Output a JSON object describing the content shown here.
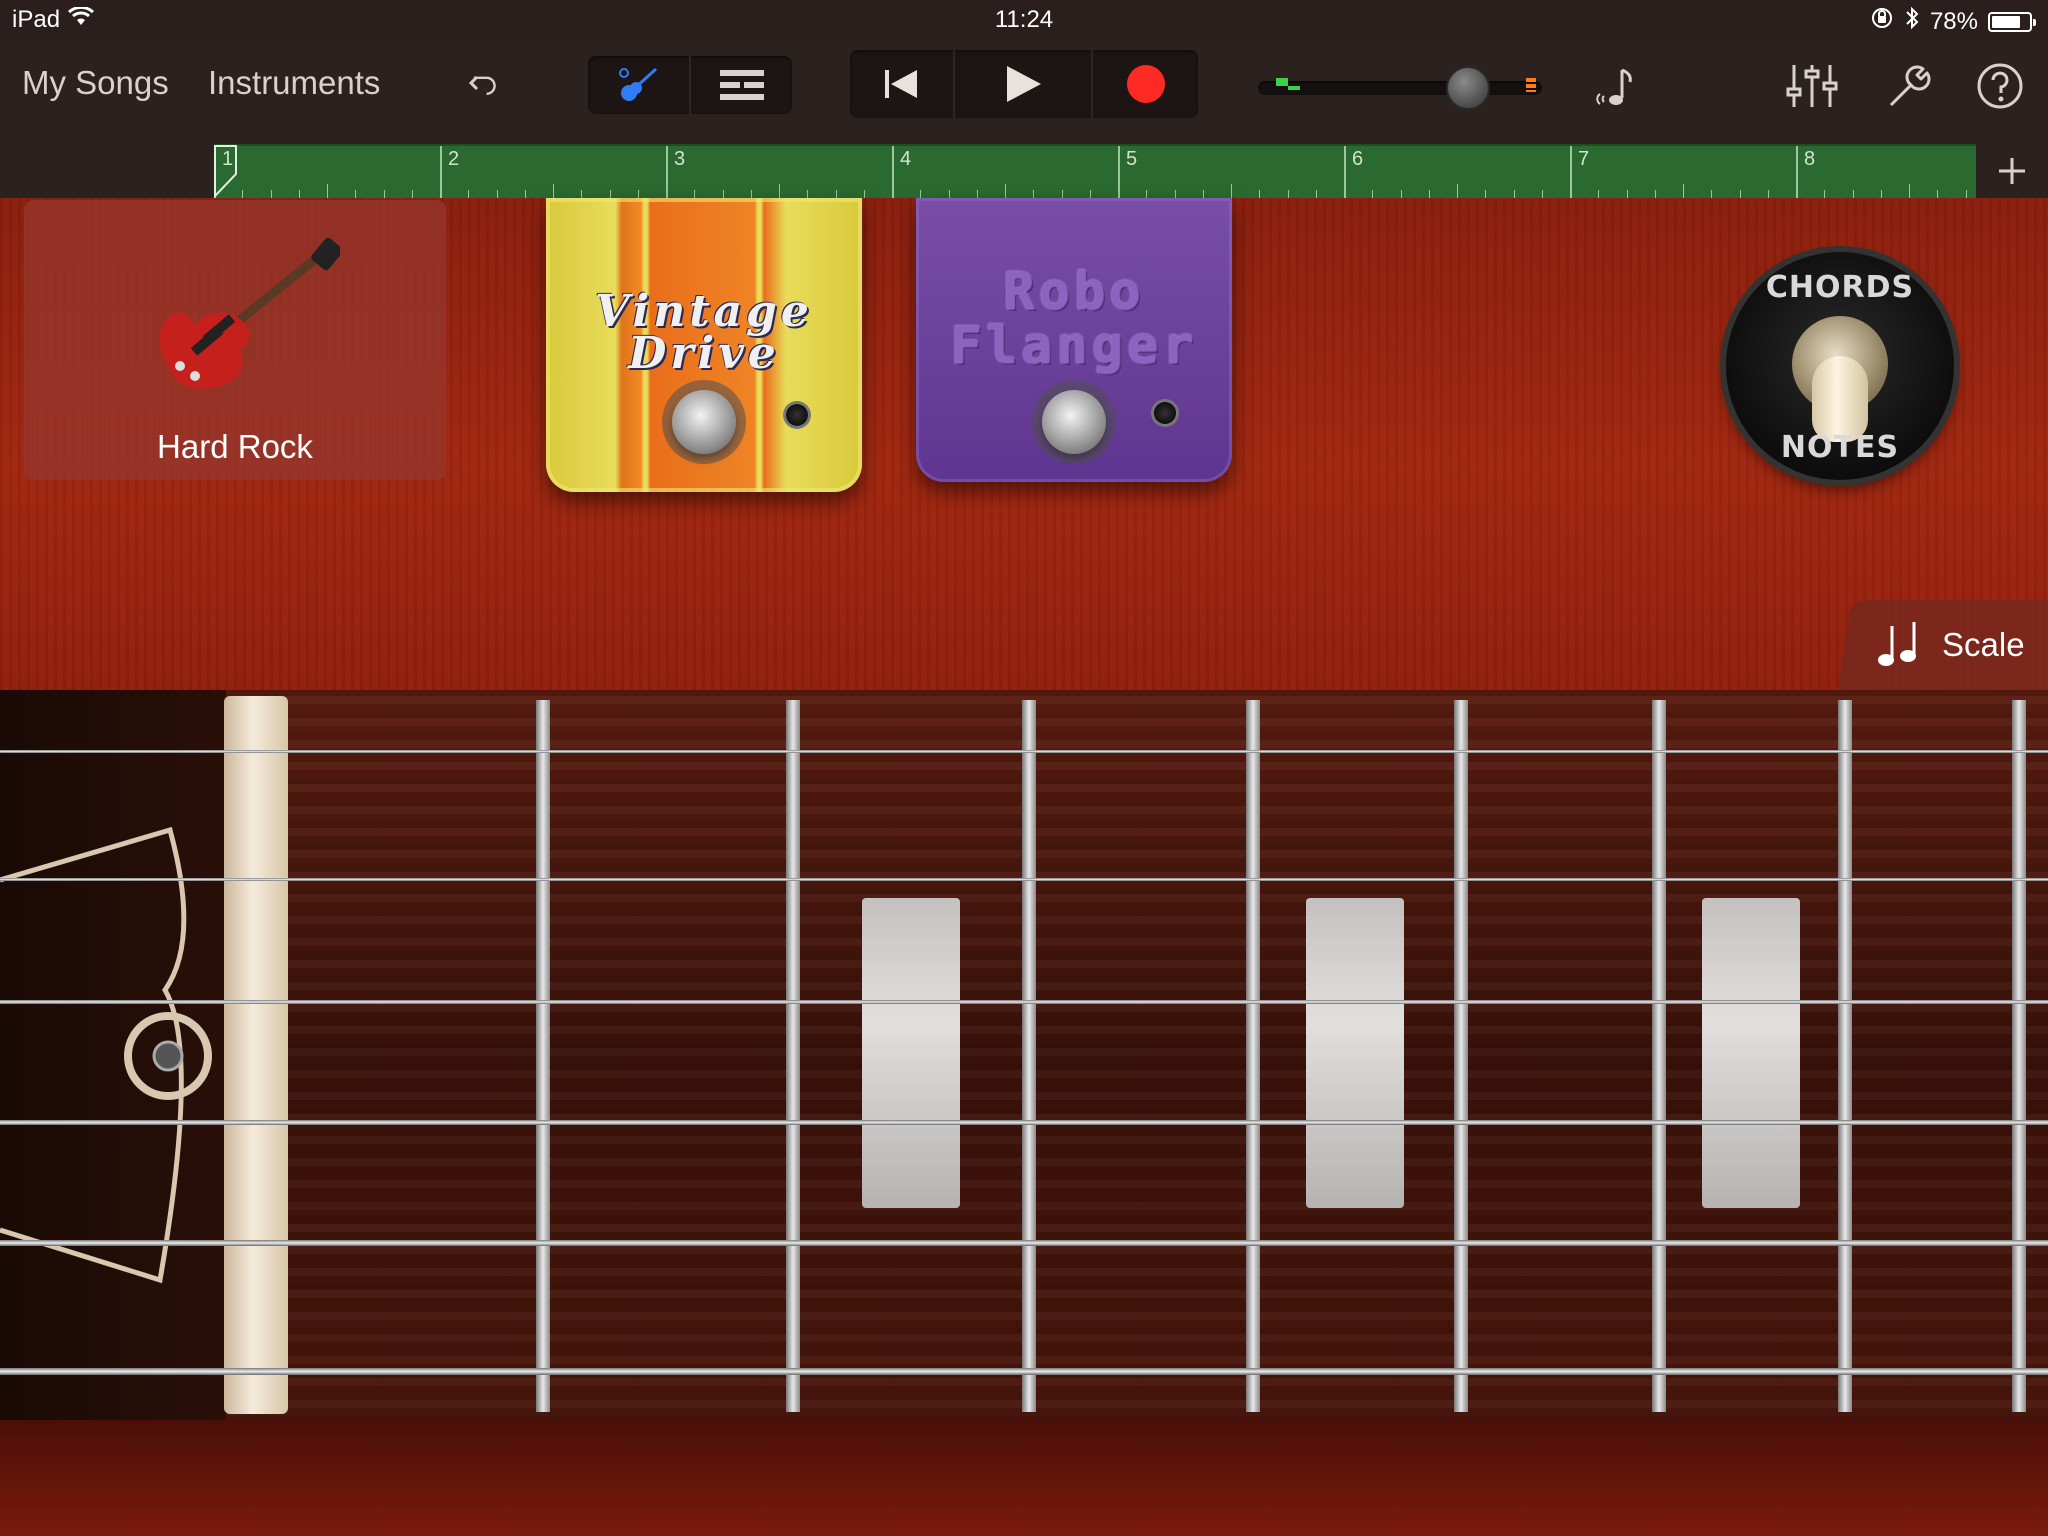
{
  "status_bar": {
    "device": "iPad",
    "time": "11:24",
    "battery_percent": "78%",
    "battery_level": 0.78
  },
  "toolbar": {
    "my_songs": "My Songs",
    "instruments": "Instruments",
    "accent_color": "#2f7cf6",
    "record_color": "#ff2a24",
    "volume_level": 0.74
  },
  "ruler": {
    "bars": [
      "1",
      "2",
      "3",
      "4",
      "5",
      "6",
      "7",
      "8"
    ]
  },
  "instrument": {
    "preset_name": "Hard Rock"
  },
  "pedals": {
    "pedal1_title_line1": "Vintage",
    "pedal1_title_line2": "Drive",
    "pedal2_title_line1": "Robo",
    "pedal2_title_line2": "Flanger"
  },
  "mode_switch": {
    "top_label": "CHORDS",
    "bottom_label": "NOTES"
  },
  "scale_button": {
    "label": "Scale"
  },
  "colors": {
    "wood": "#8a1d0c",
    "ruler_green": "#2a6a30"
  }
}
